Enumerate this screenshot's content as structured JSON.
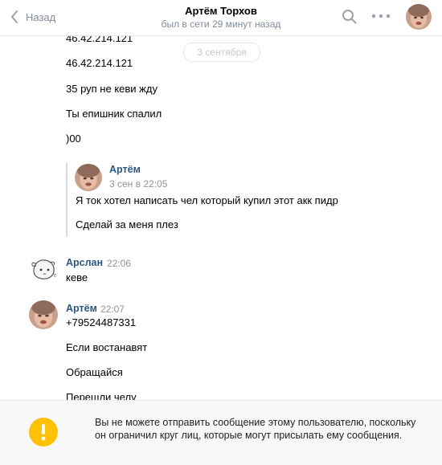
{
  "header": {
    "back_label": "Назад",
    "title": "Артём Торхов",
    "subtitle": "был в сети 29 минут назад"
  },
  "date_divider": "3 сентября",
  "messages_top": [
    "46.42.214.121",
    "46.42.214.121",
    "35 руп не кеви жду",
    "Ты епишник спалил",
    ")00"
  ],
  "forwarded": {
    "name": "Артём",
    "time": "3 сен в 22:05",
    "lines": [
      "Я ток хотел написать чел который купил этот акк пидр",
      "Сделай за меня плез"
    ]
  },
  "arslan": {
    "name": "Арслан",
    "time": "22:06",
    "text": "кеве"
  },
  "artem": {
    "name": "Артём",
    "time": "22:07",
    "lines": [
      "+79524487331",
      "Если востанавят",
      "Обращайся",
      "Перешли челу"
    ]
  },
  "footer": {
    "notice": "Вы не можете отправить сообщение этому пользователю, поскольку он ограничил круг лиц, которые могут присылать ему сообщения."
  },
  "colors": {
    "link_name": "#2a5885",
    "muted": "#818c99",
    "warning": "#ffc107"
  },
  "icons": [
    "chevron-left-icon",
    "search-icon",
    "more-dots-icon",
    "warning-icon"
  ]
}
